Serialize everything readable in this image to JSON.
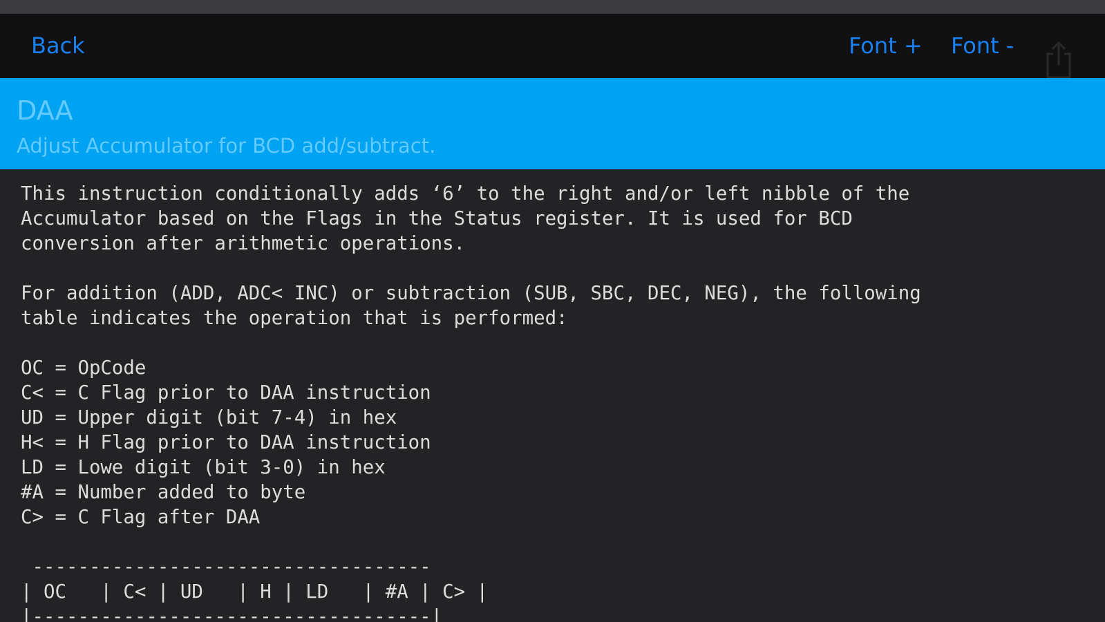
{
  "nav": {
    "back_label": "Back",
    "font_plus_label": "Font +",
    "font_minus_label": "Font -",
    "share_icon": "share-icon"
  },
  "header": {
    "title": "DAA",
    "subtitle": "Adjust Accumulator for BCD add/subtract."
  },
  "content": {
    "text": "This instruction conditionally adds ‘6’ to the right and/or left nibble of the\nAccumulator based on the Flags in the Status register. It is used for BCD\nconversion after arithmetic operations.\n\nFor addition (ADD, ADC< INC) or subtraction (SUB, SBC, DEC, NEG), the following\ntable indicates the operation that is performed:\n\nOC = OpCode\nC< = C Flag prior to DAA instruction\nUD = Upper digit (bit 7-4) in hex\nH< = H Flag prior to DAA instruction\nLD = Lowe digit (bit 3-0) in hex\n#A = Number added to byte\nC> = C Flag after DAA\n\n -----------------------------------\n| OC   | C< | UD   | H | LD   | #A | C> |\n|-----------------------------------|"
  },
  "colors": {
    "accent": "#1a7ff0",
    "header_band": "#00a2f2",
    "header_text": "#63cbff",
    "background": "#232325",
    "navbar": "#111112",
    "body_text": "#dcdcdc"
  }
}
